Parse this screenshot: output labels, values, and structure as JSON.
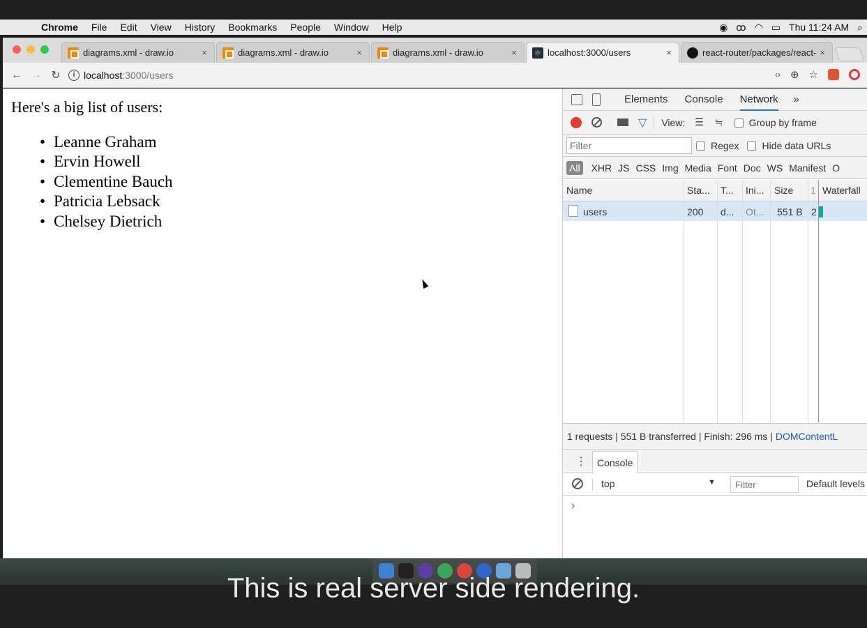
{
  "menubar": {
    "apple": "",
    "app": "Chrome",
    "items": [
      "File",
      "Edit",
      "View",
      "History",
      "Bookmarks",
      "People",
      "Window",
      "Help"
    ],
    "clock": "Thu 11:24 AM"
  },
  "tabs": [
    {
      "title": "diagrams.xml - draw.io",
      "icon": "drawio-icon"
    },
    {
      "title": "diagrams.xml - draw.io",
      "icon": "drawio-icon"
    },
    {
      "title": "diagrams.xml - draw.io",
      "icon": "drawio-icon"
    },
    {
      "title": "localhost:3000/users",
      "icon": "react-icon"
    },
    {
      "title": "react-router/packages/react-",
      "icon": "github-icon"
    }
  ],
  "address": {
    "host": "localhost",
    "path": ":3000/users"
  },
  "page": {
    "heading": "Here's a big list of users:",
    "users": [
      "Leanne Graham",
      "Ervin Howell",
      "Clementine Bauch",
      "Patricia Lebsack",
      "Chelsey Dietrich"
    ]
  },
  "devtools": {
    "tabs": [
      "Elements",
      "Console",
      "Network",
      "»"
    ],
    "active_tab": "Network",
    "toolbar": {
      "view_label": "View:",
      "group_by_frame": "Group by frame"
    },
    "filter": {
      "placeholder": "Filter",
      "regex": "Regex",
      "hide_data_urls": "Hide data URLs"
    },
    "types": [
      "All",
      "XHR",
      "JS",
      "CSS",
      "Img",
      "Media",
      "Font",
      "Doc",
      "WS",
      "Manifest",
      "O"
    ],
    "columns": [
      "Name",
      "Sta...",
      "T...",
      "Ini...",
      "Size",
      "1",
      "Waterfall"
    ],
    "rows": [
      {
        "name": "users",
        "status": "200",
        "type": "d...",
        "initiator": "Ot...",
        "size": "551 B",
        "time": "2"
      }
    ],
    "summary": {
      "text": "1 requests  |  551 B transferred  |  Finish: 296 ms  |  ",
      "link": "DOMContentL"
    },
    "drawer": {
      "tab": "Console",
      "context": "top",
      "filter_placeholder": "Filter",
      "levels": "Default levels",
      "prompt": "›"
    }
  },
  "caption": "This is real server side rendering."
}
